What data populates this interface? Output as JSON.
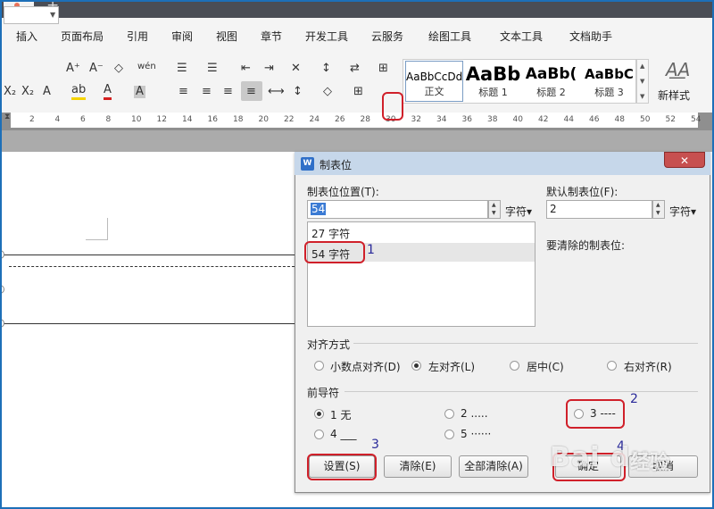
{
  "app": {
    "new_tab": "+"
  },
  "menu": [
    "插入",
    "页面布局",
    "引用",
    "审阅",
    "视图",
    "章节",
    "开发工具",
    "云服务",
    "绘图工具",
    "文本工具",
    "文档助手"
  ],
  "toolbar": {
    "row1": [
      "A⁺",
      "A⁻",
      "◇",
      "wén",
      "☰",
      "☰",
      "⇤",
      "⇥",
      "✕",
      "↕",
      "⇄",
      "⊞"
    ],
    "row2": [
      "X₂",
      "A",
      "ab",
      "A",
      "A",
      "≡",
      "≡",
      "≡",
      "≡",
      "⟷",
      "↕",
      "◇",
      "⊞"
    ],
    "highlight_color": "#f5d300",
    "font_color": "#d42020"
  },
  "styles": [
    {
      "sample": "AaBbCcDd",
      "name": "正文"
    },
    {
      "sample": "AaBb",
      "name": "标题 1"
    },
    {
      "sample": "AaBb(",
      "name": "标题 2"
    },
    {
      "sample": "AaBbC",
      "name": "标题 3"
    }
  ],
  "new_style": "新样式",
  "ruler": [
    "2",
    "4",
    "6",
    "8",
    "10",
    "12",
    "14",
    "16",
    "18",
    "20",
    "22",
    "24",
    "26",
    "28",
    "30",
    "32",
    "34",
    "36",
    "38",
    "40",
    "42",
    "44",
    "46",
    "48",
    "50",
    "52",
    "54"
  ],
  "dialog": {
    "icon": "W",
    "title": "制表位",
    "close": "✕",
    "tab_position_label": "制表位位置(T):",
    "tab_position_value": "54",
    "tab_position_unit": "字符▾",
    "default_tab_label": "默认制表位(F):",
    "default_tab_value": "2",
    "default_tab_unit": "字符▾",
    "positions": [
      "27 字符",
      "54 字符"
    ],
    "to_clear_label": "要清除的制表位:",
    "alignment_label": "对齐方式",
    "alignment": [
      "小数点对齐(D)",
      "左对齐(L)",
      "居中(C)",
      "右对齐(R)"
    ],
    "leader_label": "前导符",
    "leaders": [
      "1 无",
      "2 .....",
      "3 ----",
      "4 ___",
      "5 ······"
    ],
    "buttons": {
      "set": "设置(S)",
      "clear": "清除(E)",
      "clear_all": "全部清除(A)",
      "ok": "确定",
      "cancel": "取消"
    }
  },
  "annotations": [
    "1",
    "2",
    "3",
    "4"
  ],
  "watermark": {
    "logo": "Bai du",
    "text": "经验"
  }
}
